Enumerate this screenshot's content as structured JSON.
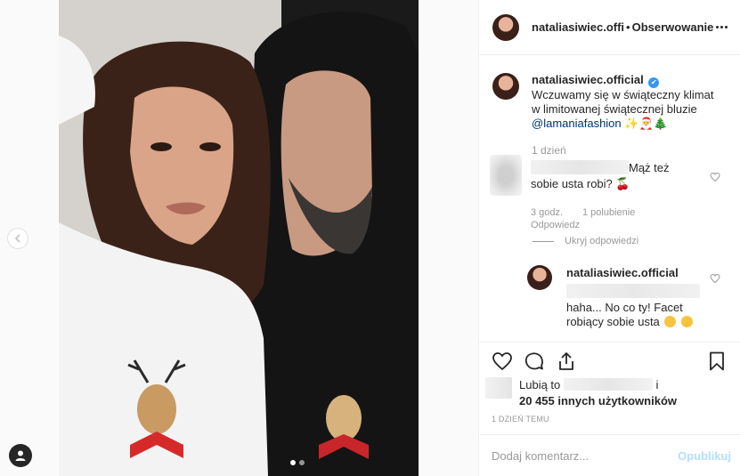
{
  "colors": {
    "link": "#003569",
    "verified": "#3897f0",
    "muted": "#999999",
    "publish_disabled": "#b2dffc"
  },
  "header": {
    "username": "nataliasiwiec.offi",
    "separator": "•",
    "follow_label": "Obserwowanie",
    "more_icon": "more-horizontal-icon"
  },
  "caption": {
    "username": "nataliasiwiec.official",
    "text": " Wczuwamy się w świąteczny klimat w limitowanej świątecznej bluzie ",
    "mention": "@lamaniafashion",
    "emojis": "✨🎅🎄",
    "time": "1 dzień"
  },
  "comment1": {
    "text": "Mąż też sobie usta robi? 🍒",
    "time": "3 godz.",
    "likes": "1 polubienie",
    "reply_label": "Odpowiedz",
    "hide_replies": "Ukryj odpowiedzi"
  },
  "reply1": {
    "username": "nataliasiwiec.official",
    "text": "haha... No co ty! Facet robiący sobie usta"
  },
  "likes": {
    "prefix": "Lubią to",
    "suffix": "i",
    "count_text": "20 455 innych użytkowników"
  },
  "date": "1 DZIEŃ TEMU",
  "add_comment": {
    "placeholder": "Dodaj komentarz...",
    "publish_label": "Opublikuj"
  },
  "icons": {
    "like": "heart-icon",
    "comment": "comment-icon",
    "share": "share-icon",
    "save": "bookmark-icon",
    "prev": "chevron-left-icon",
    "tags": "user-tag-icon"
  }
}
